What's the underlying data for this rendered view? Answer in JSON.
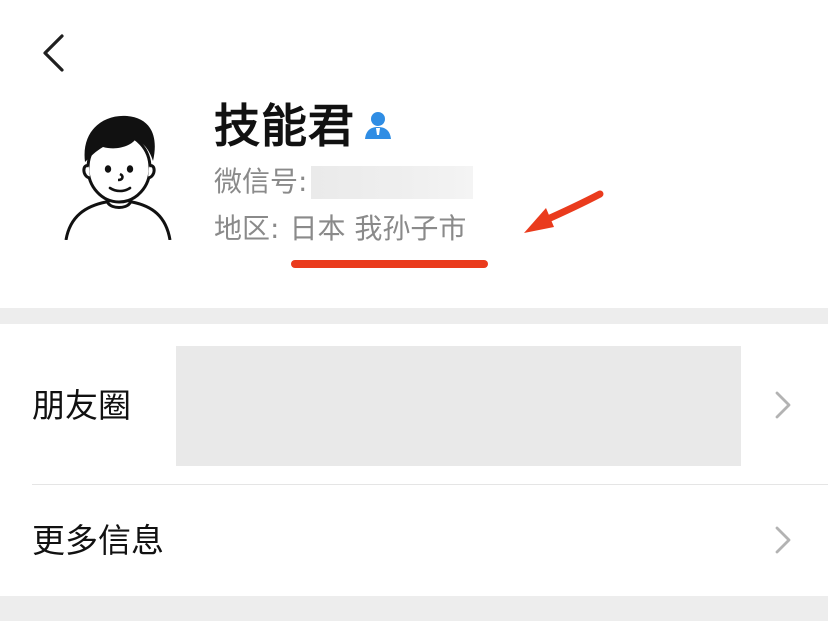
{
  "profile": {
    "name": "技能君",
    "wechat_label": "微信号:",
    "region_label": "地区:",
    "region_value": "日本 我孙子市"
  },
  "rows": {
    "moments_label": "朋友圈",
    "more_info_label": "更多信息"
  },
  "icons": {
    "back": "chevron-left-icon",
    "contact": "person-icon",
    "row_arrow": "chevron-right-icon"
  },
  "colors": {
    "annotation": "#ea3b1d",
    "contact_icon": "#2f8de4",
    "muted_text": "#8a8a8a",
    "divider": "#ededed"
  }
}
